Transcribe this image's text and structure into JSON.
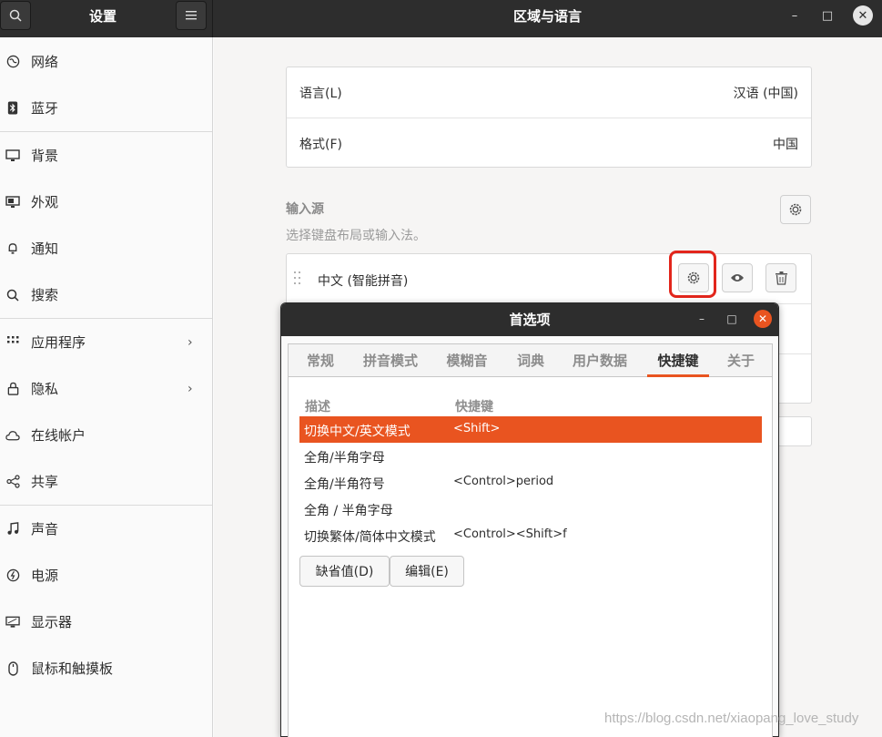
{
  "window": {
    "sidebar_title": "设置",
    "main_title": "区域与语言"
  },
  "sidebar": {
    "items": [
      {
        "label": "网络",
        "icon": "network-icon"
      },
      {
        "label": "蓝牙",
        "icon": "bluetooth-icon"
      },
      {
        "label": "背景",
        "icon": "background-icon"
      },
      {
        "label": "外观",
        "icon": "appearance-icon"
      },
      {
        "label": "通知",
        "icon": "bell-icon"
      },
      {
        "label": "搜索",
        "icon": "search-icon"
      },
      {
        "label": "应用程序",
        "icon": "apps-grid-icon",
        "chevron": "›"
      },
      {
        "label": "隐私",
        "icon": "lock-icon",
        "chevron": "›"
      },
      {
        "label": "在线帐户",
        "icon": "cloud-icon"
      },
      {
        "label": "共享",
        "icon": "share-icon"
      },
      {
        "label": "声音",
        "icon": "music-note-icon"
      },
      {
        "label": "电源",
        "icon": "power-icon"
      },
      {
        "label": "显示器",
        "icon": "display-icon"
      },
      {
        "label": "鼠标和触摸板",
        "icon": "mouse-icon"
      }
    ]
  },
  "region": {
    "language_label": "语言(L)",
    "language_value": "汉语 (中国)",
    "format_label": "格式(F)",
    "format_value": "中国"
  },
  "input_sources": {
    "title": "输入源",
    "subtitle": "选择键盘布局或输入法。",
    "source_name": "中文 (智能拼音)"
  },
  "dialog": {
    "title": "首选项",
    "tabs": [
      {
        "label": "常规"
      },
      {
        "label": "拼音模式"
      },
      {
        "label": "模糊音"
      },
      {
        "label": "词典"
      },
      {
        "label": "用户数据"
      },
      {
        "label": "快捷键",
        "active": true
      },
      {
        "label": "关于"
      }
    ],
    "columns": {
      "desc": "描述",
      "shortcut": "快捷键"
    },
    "rows": [
      {
        "desc": "切换中文/英文模式",
        "shortcut": "<Shift>"
      },
      {
        "desc": "全角/半角字母",
        "shortcut": ""
      },
      {
        "desc": "全角/半角符号",
        "shortcut": "<Control>period"
      },
      {
        "desc": "全角 / 半角字母",
        "shortcut": ""
      },
      {
        "desc": "切换繁体/简体中文模式",
        "shortcut": "<Control><Shift>f"
      }
    ],
    "default_button": "缺省值(D)",
    "edit_button": "编辑(E)"
  },
  "watermark": "https://blog.csdn.net/xiaopang_love_study",
  "colors": {
    "accent": "#e95420",
    "highlight_ring": "#e2261c",
    "headerbar": "#2d2d2d"
  }
}
